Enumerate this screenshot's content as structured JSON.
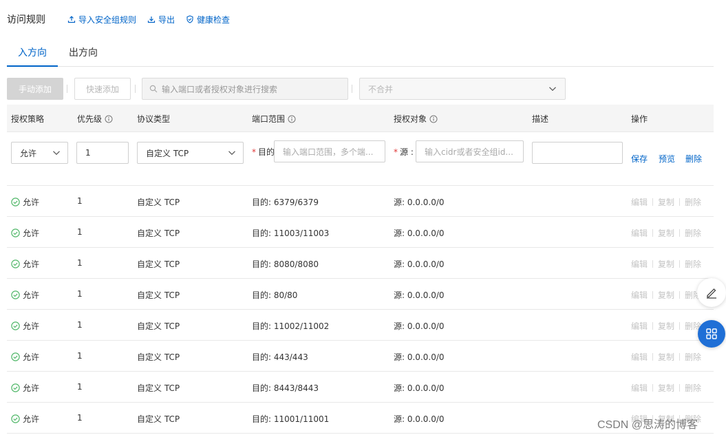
{
  "header": {
    "title": "访问规则",
    "import_label": "导入安全组规则",
    "export_label": "导出",
    "health_label": "健康检查"
  },
  "tabs": [
    {
      "label": "入方向",
      "active": true
    },
    {
      "label": "出方向",
      "active": false
    }
  ],
  "toolbar": {
    "manual_add": "手动添加",
    "quick_add": "快速添加",
    "search_placeholder": "输入端口或者授权对象进行搜索",
    "merge_select": "不合并"
  },
  "columns": [
    "授权策略",
    "优先级",
    "协议类型",
    "端口范围",
    "授权对象",
    "描述",
    "操作"
  ],
  "edit_row": {
    "policy": "允许",
    "priority": "1",
    "protocol": "自定义 TCP",
    "dest_label": "目的",
    "port_placeholder": "输入端口范围，多个端...",
    "src_label": "源",
    "cidr_placeholder": "输入cidr或者安全组id...",
    "description": "",
    "actions": [
      "保存",
      "预览",
      "删除"
    ]
  },
  "rows": [
    {
      "policy": "允许",
      "priority": "1",
      "protocol": "自定义 TCP",
      "port": "目的: 6379/6379",
      "source": "源: 0.0.0.0/0"
    },
    {
      "policy": "允许",
      "priority": "1",
      "protocol": "自定义 TCP",
      "port": "目的: 11003/11003",
      "source": "源: 0.0.0.0/0"
    },
    {
      "policy": "允许",
      "priority": "1",
      "protocol": "自定义 TCP",
      "port": "目的: 8080/8080",
      "source": "源: 0.0.0.0/0"
    },
    {
      "policy": "允许",
      "priority": "1",
      "protocol": "自定义 TCP",
      "port": "目的: 80/80",
      "source": "源: 0.0.0.0/0"
    },
    {
      "policy": "允许",
      "priority": "1",
      "protocol": "自定义 TCP",
      "port": "目的: 11002/11002",
      "source": "源: 0.0.0.0/0"
    },
    {
      "policy": "允许",
      "priority": "1",
      "protocol": "自定义 TCP",
      "port": "目的: 443/443",
      "source": "源: 0.0.0.0/0"
    },
    {
      "policy": "允许",
      "priority": "1",
      "protocol": "自定义 TCP",
      "port": "目的: 8443/8443",
      "source": "源: 0.0.0.0/0"
    },
    {
      "policy": "允许",
      "priority": "1",
      "protocol": "自定义 TCP",
      "port": "目的: 11001/11001",
      "source": "源: 0.0.0.0/0"
    }
  ],
  "row_actions": [
    "编辑",
    "复制",
    "删除"
  ],
  "watermark": "CSDN @思涛的博客",
  "colors": {
    "accent": "#0064c8",
    "success": "#52b86a",
    "float_button": "#1f6fd6"
  }
}
